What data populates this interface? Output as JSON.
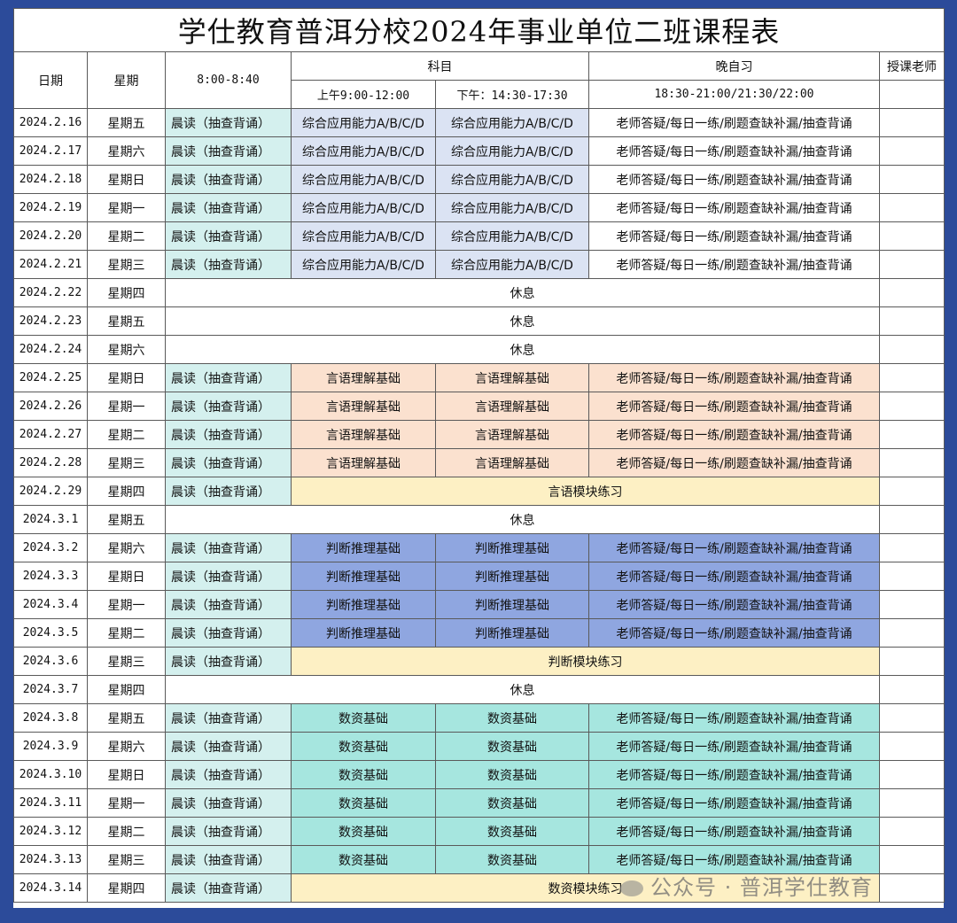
{
  "title": "学仕教育普洱分校2024年事业单位二班课程表",
  "headers": {
    "date": "日期",
    "weekday": "星期",
    "early": "8:00-8:40",
    "subject": "科目",
    "am": "上午9:00-12:00",
    "pm": "下午：14:30-17:30",
    "evening": "晚自习",
    "evening_time": "18:30-21:00/21:30/22:00",
    "teacher": "授课老师"
  },
  "rows": [
    {
      "date": "2024.2.16",
      "weekday": "星期五",
      "type": "class",
      "early": "晨读（抽查背诵）",
      "am": "综合应用能力A/B/C/D",
      "pm": "综合应用能力A/B/C/D",
      "evening": "老师答疑/每日一练/刷题查缺补漏/抽查背诵",
      "style": "zonghe"
    },
    {
      "date": "2024.2.17",
      "weekday": "星期六",
      "type": "class",
      "early": "晨读（抽查背诵）",
      "am": "综合应用能力A/B/C/D",
      "pm": "综合应用能力A/B/C/D",
      "evening": "老师答疑/每日一练/刷题查缺补漏/抽查背诵",
      "style": "zonghe"
    },
    {
      "date": "2024.2.18",
      "weekday": "星期日",
      "type": "class",
      "early": "晨读（抽查背诵）",
      "am": "综合应用能力A/B/C/D",
      "pm": "综合应用能力A/B/C/D",
      "evening": "老师答疑/每日一练/刷题查缺补漏/抽查背诵",
      "style": "zonghe"
    },
    {
      "date": "2024.2.19",
      "weekday": "星期一",
      "type": "class",
      "early": "晨读（抽查背诵）",
      "am": "综合应用能力A/B/C/D",
      "pm": "综合应用能力A/B/C/D",
      "evening": "老师答疑/每日一练/刷题查缺补漏/抽查背诵",
      "style": "zonghe"
    },
    {
      "date": "2024.2.20",
      "weekday": "星期二",
      "type": "class",
      "early": "晨读（抽查背诵）",
      "am": "综合应用能力A/B/C/D",
      "pm": "综合应用能力A/B/C/D",
      "evening": "老师答疑/每日一练/刷题查缺补漏/抽查背诵",
      "style": "zonghe"
    },
    {
      "date": "2024.2.21",
      "weekday": "星期三",
      "type": "class",
      "early": "晨读（抽查背诵）",
      "am": "综合应用能力A/B/C/D",
      "pm": "综合应用能力A/B/C/D",
      "evening": "老师答疑/每日一练/刷题查缺补漏/抽查背诵",
      "style": "zonghe"
    },
    {
      "date": "2024.2.22",
      "weekday": "星期四",
      "type": "rest",
      "text": "休息"
    },
    {
      "date": "2024.2.23",
      "weekday": "星期五",
      "type": "rest",
      "text": "休息"
    },
    {
      "date": "2024.2.24",
      "weekday": "星期六",
      "type": "rest",
      "text": "休息"
    },
    {
      "date": "2024.2.25",
      "weekday": "星期日",
      "type": "class",
      "early": "晨读（抽查背诵）",
      "am": "言语理解基础",
      "pm": "言语理解基础",
      "evening": "老师答疑/每日一练/刷题查缺补漏/抽查背诵",
      "style": "yanyu"
    },
    {
      "date": "2024.2.26",
      "weekday": "星期一",
      "type": "class",
      "early": "晨读（抽查背诵）",
      "am": "言语理解基础",
      "pm": "言语理解基础",
      "evening": "老师答疑/每日一练/刷题查缺补漏/抽查背诵",
      "style": "yanyu"
    },
    {
      "date": "2024.2.27",
      "weekday": "星期二",
      "type": "class",
      "early": "晨读（抽查背诵）",
      "am": "言语理解基础",
      "pm": "言语理解基础",
      "evening": "老师答疑/每日一练/刷题查缺补漏/抽查背诵",
      "style": "yanyu"
    },
    {
      "date": "2024.2.28",
      "weekday": "星期三",
      "type": "class",
      "early": "晨读（抽查背诵）",
      "am": "言语理解基础",
      "pm": "言语理解基础",
      "evening": "老师答疑/每日一练/刷题查缺补漏/抽查背诵",
      "style": "yanyu"
    },
    {
      "date": "2024.2.29",
      "weekday": "星期四",
      "type": "practice",
      "early": "晨读（抽查背诵）",
      "text": "言语模块练习"
    },
    {
      "date": "2024.3.1",
      "weekday": "星期五",
      "type": "rest",
      "text": "休息"
    },
    {
      "date": "2024.3.2",
      "weekday": "星期六",
      "type": "class",
      "early": "晨读（抽查背诵）",
      "am": "判断推理基础",
      "pm": "判断推理基础",
      "evening": "老师答疑/每日一练/刷题查缺补漏/抽查背诵",
      "style": "panduan"
    },
    {
      "date": "2024.3.3",
      "weekday": "星期日",
      "type": "class",
      "early": "晨读（抽查背诵）",
      "am": "判断推理基础",
      "pm": "判断推理基础",
      "evening": "老师答疑/每日一练/刷题查缺补漏/抽查背诵",
      "style": "panduan"
    },
    {
      "date": "2024.3.4",
      "weekday": "星期一",
      "type": "class",
      "early": "晨读（抽查背诵）",
      "am": "判断推理基础",
      "pm": "判断推理基础",
      "evening": "老师答疑/每日一练/刷题查缺补漏/抽查背诵",
      "style": "panduan"
    },
    {
      "date": "2024.3.5",
      "weekday": "星期二",
      "type": "class",
      "early": "晨读（抽查背诵）",
      "am": "判断推理基础",
      "pm": "判断推理基础",
      "evening": "老师答疑/每日一练/刷题查缺补漏/抽查背诵",
      "style": "panduan"
    },
    {
      "date": "2024.3.6",
      "weekday": "星期三",
      "type": "practice",
      "early": "晨读（抽查背诵）",
      "text": "判断模块练习"
    },
    {
      "date": "2024.3.7",
      "weekday": "星期四",
      "type": "rest",
      "text": "休息"
    },
    {
      "date": "2024.3.8",
      "weekday": "星期五",
      "type": "class",
      "early": "晨读（抽查背诵）",
      "am": "数资基础",
      "pm": "数资基础",
      "evening": "老师答疑/每日一练/刷题查缺补漏/抽查背诵",
      "style": "shuzi"
    },
    {
      "date": "2024.3.9",
      "weekday": "星期六",
      "type": "class",
      "early": "晨读（抽查背诵）",
      "am": "数资基础",
      "pm": "数资基础",
      "evening": "老师答疑/每日一练/刷题查缺补漏/抽查背诵",
      "style": "shuzi"
    },
    {
      "date": "2024.3.10",
      "weekday": "星期日",
      "type": "class",
      "early": "晨读（抽查背诵）",
      "am": "数资基础",
      "pm": "数资基础",
      "evening": "老师答疑/每日一练/刷题查缺补漏/抽查背诵",
      "style": "shuzi"
    },
    {
      "date": "2024.3.11",
      "weekday": "星期一",
      "type": "class",
      "early": "晨读（抽查背诵）",
      "am": "数资基础",
      "pm": "数资基础",
      "evening": "老师答疑/每日一练/刷题查缺补漏/抽查背诵",
      "style": "shuzi"
    },
    {
      "date": "2024.3.12",
      "weekday": "星期二",
      "type": "class",
      "early": "晨读（抽查背诵）",
      "am": "数资基础",
      "pm": "数资基础",
      "evening": "老师答疑/每日一练/刷题查缺补漏/抽查背诵",
      "style": "shuzi"
    },
    {
      "date": "2024.3.13",
      "weekday": "星期三",
      "type": "class",
      "early": "晨读（抽查背诵）",
      "am": "数资基础",
      "pm": "数资基础",
      "evening": "老师答疑/每日一练/刷题查缺补漏/抽查背诵",
      "style": "shuzi"
    },
    {
      "date": "2024.3.14",
      "weekday": "星期四",
      "type": "practice",
      "early": "晨读（抽查背诵）",
      "text": "数资模块练习"
    }
  ],
  "watermark": "公众号 · 普洱学仕教育",
  "colors": {
    "frame": "#2c4b9a",
    "zonghe": "#dbe3f3",
    "yanyu": "#fbe1cf",
    "panduan": "#8fa6e0",
    "shuzi": "#a6e6df",
    "practice": "#fdf0c4",
    "morning": "#d4f0ee"
  }
}
